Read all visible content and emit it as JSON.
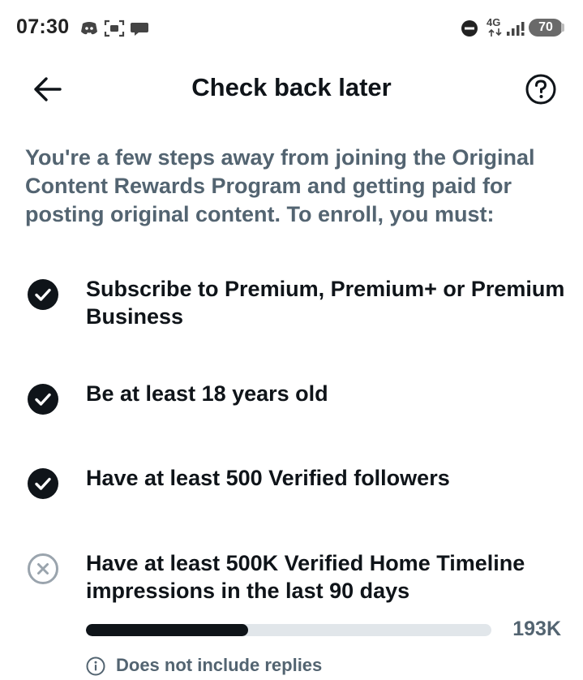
{
  "status_bar": {
    "time": "07:30",
    "left_icons": [
      "discord-icon",
      "screenshot-icon",
      "chat-bubble-icon"
    ],
    "right_icons": [
      "do-not-disturb-icon",
      "network-4g-icon",
      "signal-icon"
    ],
    "network_label": "4G",
    "battery_level": "70"
  },
  "header": {
    "title": "Check back later",
    "back_icon": "arrow-left-icon",
    "help_icon": "question-circle-icon"
  },
  "intro_text": "You're a few steps away from joining the Original Content Rewards Program and getting paid for posting original content. To enroll, you must:",
  "requirements": [
    {
      "text": "Subscribe to Premium, Premium+ or Premium Business",
      "status": "complete"
    },
    {
      "text": "Be at least 18 years old",
      "status": "complete"
    },
    {
      "text": "Have at least 500 Verified followers",
      "status": "complete"
    },
    {
      "text": "Have at least 500K Verified Home Timeline impressions in the last 90 days",
      "status": "incomplete"
    }
  ],
  "impressions_progress": {
    "current_label": "193K",
    "fraction": 0.4
  },
  "note": {
    "icon": "info-icon",
    "text": "Does not include replies"
  },
  "colors": {
    "primary_text": "#0f1419",
    "secondary_text": "#536471",
    "progress_track": "#e1e6ea",
    "incomplete_icon": "#9aa4ad"
  }
}
